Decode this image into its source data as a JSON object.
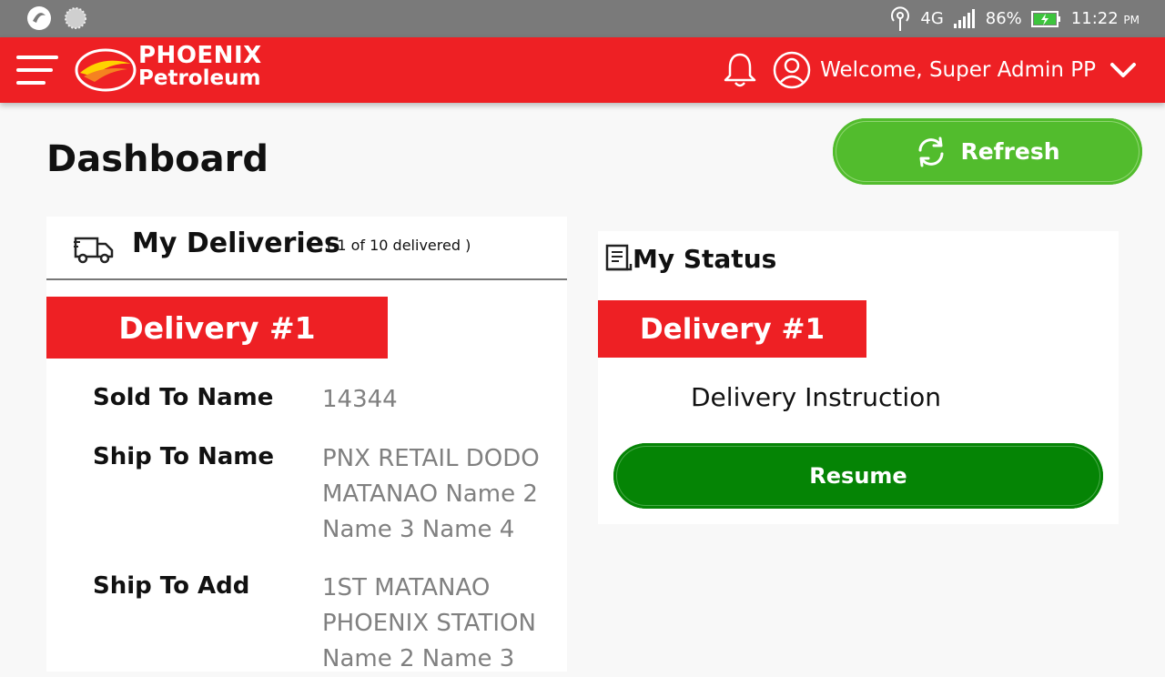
{
  "status_bar": {
    "network": "4G",
    "battery": "86%",
    "time": "11:22",
    "ampm": "PM"
  },
  "header": {
    "brand_line1": "PHOENIX",
    "brand_line2": "Petroleum",
    "welcome": "Welcome, Super Admin PP"
  },
  "page": {
    "title": "Dashboard",
    "refresh_label": "Refresh"
  },
  "deliveries": {
    "title": "My Deliveries",
    "count_text": "( 1 of 10 delivered )",
    "banner": "Delivery #1",
    "fields": [
      {
        "label": "Sold To Name",
        "value": "14344"
      },
      {
        "label": "Ship To Name",
        "value": "PNX RETAIL DODO MATANAO Name 2 Name 3 Name 4"
      },
      {
        "label": "Ship To Add",
        "value": "1ST MATANAO PHOENIX STATION Name 2 Name 3"
      }
    ]
  },
  "status": {
    "title": "My Status",
    "banner": "Delivery #1",
    "instruction": "Delivery Instruction",
    "resume_label": "Resume"
  },
  "colors": {
    "brand_red": "#ee2024",
    "refresh_green": "#52bc2d",
    "resume_green": "#058405"
  }
}
